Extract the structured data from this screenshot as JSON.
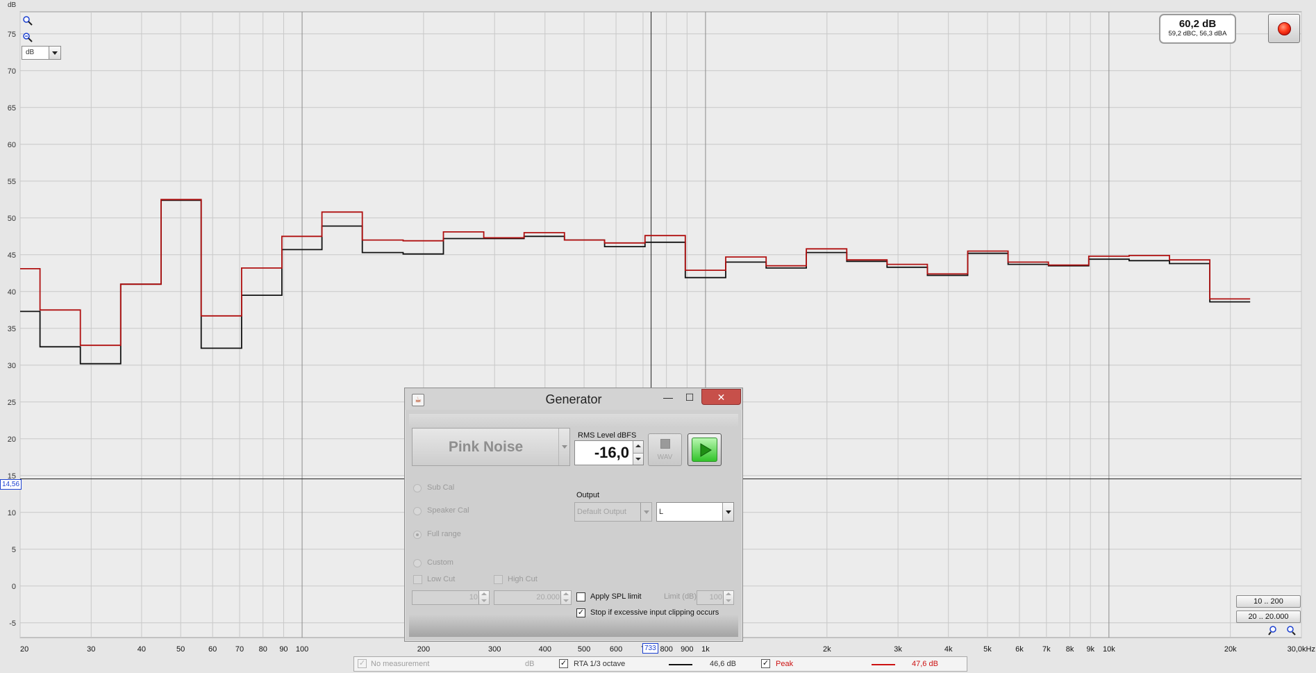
{
  "graph": {
    "y_axis_unit": "dB",
    "y_ticks": [
      "75",
      "70",
      "65",
      "60",
      "55",
      "50",
      "45",
      "40",
      "35",
      "30",
      "25",
      "20",
      "15",
      "10",
      "5",
      "0",
      "-5"
    ],
    "x_ticks": [
      "20",
      "30",
      "40",
      "50",
      "60",
      "70",
      "80",
      "90",
      "100",
      "200",
      "300",
      "400",
      "500",
      "600",
      "7",
      "800",
      "900",
      "1k",
      "2k",
      "3k",
      "4k",
      "5k",
      "6k",
      "7k",
      "8k",
      "9k",
      "10k",
      "20k",
      "30,0kHz"
    ],
    "cursor_level": "14,56",
    "cursor_freq": "733",
    "background": "#ececec",
    "grid_color": "#c8c8c8",
    "major_grid_color": "#8a8a8a"
  },
  "chart_data": {
    "type": "line",
    "x_scale": "log",
    "xlim": [
      20,
      30000
    ],
    "ylim": [
      -7,
      78
    ],
    "ylabel": "dB",
    "xlabel": "",
    "series": [
      {
        "name": "RTA 1/3 octave",
        "color": "#111111",
        "band_edges_hz": [
          20,
          22.4,
          28.2,
          35.5,
          44.7,
          56.2,
          70.8,
          89.1,
          112,
          141,
          178,
          224,
          282,
          355,
          447,
          562,
          708,
          891,
          1122,
          1413,
          1778,
          2239,
          2818,
          3548,
          4467,
          5623,
          7079,
          8913,
          11220,
          14125,
          17783,
          22387
        ],
        "values": [
          37.3,
          32.5,
          30.2,
          41.0,
          52.4,
          32.3,
          39.5,
          45.7,
          48.9,
          45.3,
          45.1,
          47.2,
          47.2,
          47.5,
          47.0,
          46.1,
          46.7,
          41.9,
          44.0,
          43.2,
          45.3,
          44.1,
          43.3,
          42.2,
          45.2,
          43.7,
          43.5,
          44.4,
          44.2,
          43.8,
          38.6
        ]
      },
      {
        "name": "Peak",
        "color": "#b01010",
        "band_edges_hz": [
          20,
          22.4,
          28.2,
          35.5,
          44.7,
          56.2,
          70.8,
          89.1,
          112,
          141,
          178,
          224,
          282,
          355,
          447,
          562,
          708,
          891,
          1122,
          1413,
          1778,
          2239,
          2818,
          3548,
          4467,
          5623,
          7079,
          8913,
          11220,
          14125,
          17783,
          22387
        ],
        "values": [
          43.1,
          37.5,
          32.7,
          41.0,
          52.5,
          36.7,
          43.2,
          47.5,
          50.8,
          47.0,
          46.9,
          48.1,
          47.3,
          48.0,
          47.0,
          46.6,
          47.6,
          42.9,
          44.7,
          43.5,
          45.8,
          44.3,
          43.7,
          42.4,
          45.5,
          44.0,
          43.6,
          44.8,
          44.9,
          44.3,
          39.0
        ]
      }
    ]
  },
  "top_left": {
    "unit_select_value": "dB",
    "zoom_in_icon": "zoom-in-icon",
    "zoom_out_icon": "zoom-out-icon"
  },
  "spl_meter": {
    "main": "60,2 dB",
    "sub": "59,2 dBC, 56,3 dBA",
    "record_color": "#e8361c"
  },
  "range_buttons": [
    "10 .. 200",
    "20 .. 20.000"
  ],
  "legend": {
    "items": [
      {
        "checked": "✓",
        "label": "No measurement",
        "unit": "dB",
        "value": "",
        "enabled": false
      },
      {
        "checked": "✓",
        "label": "RTA 1/3 octave",
        "unit": "",
        "value": "46,6 dB",
        "enabled": true,
        "color": "#111111"
      },
      {
        "checked": "✓",
        "label": "Peak",
        "unit": "",
        "value": "47,6 dB",
        "enabled": true,
        "color": "#cc1111"
      }
    ]
  },
  "generator": {
    "title": "Generator",
    "signal": "Pink Noise",
    "rms_label": "RMS Level dBFS",
    "rms_value": "-16,0",
    "wav_label": "WAV",
    "options": [
      "Sub Cal",
      "Speaker Cal",
      "Full range",
      "Custom"
    ],
    "selected_option": "Full range",
    "low_cut_label": "Low Cut",
    "high_cut_label": "High Cut",
    "low_cut_value": "10",
    "high_cut_value": "20.000",
    "output_label": "Output",
    "output_device": "Default Output",
    "output_channel": "L",
    "apply_spl_label": "Apply SPL limit",
    "limit_label": "Limit (dB)",
    "limit_value": "100",
    "stop_clipping_label": "Stop if excessive input clipping occurs",
    "stop_clipping_checked": "✓"
  }
}
